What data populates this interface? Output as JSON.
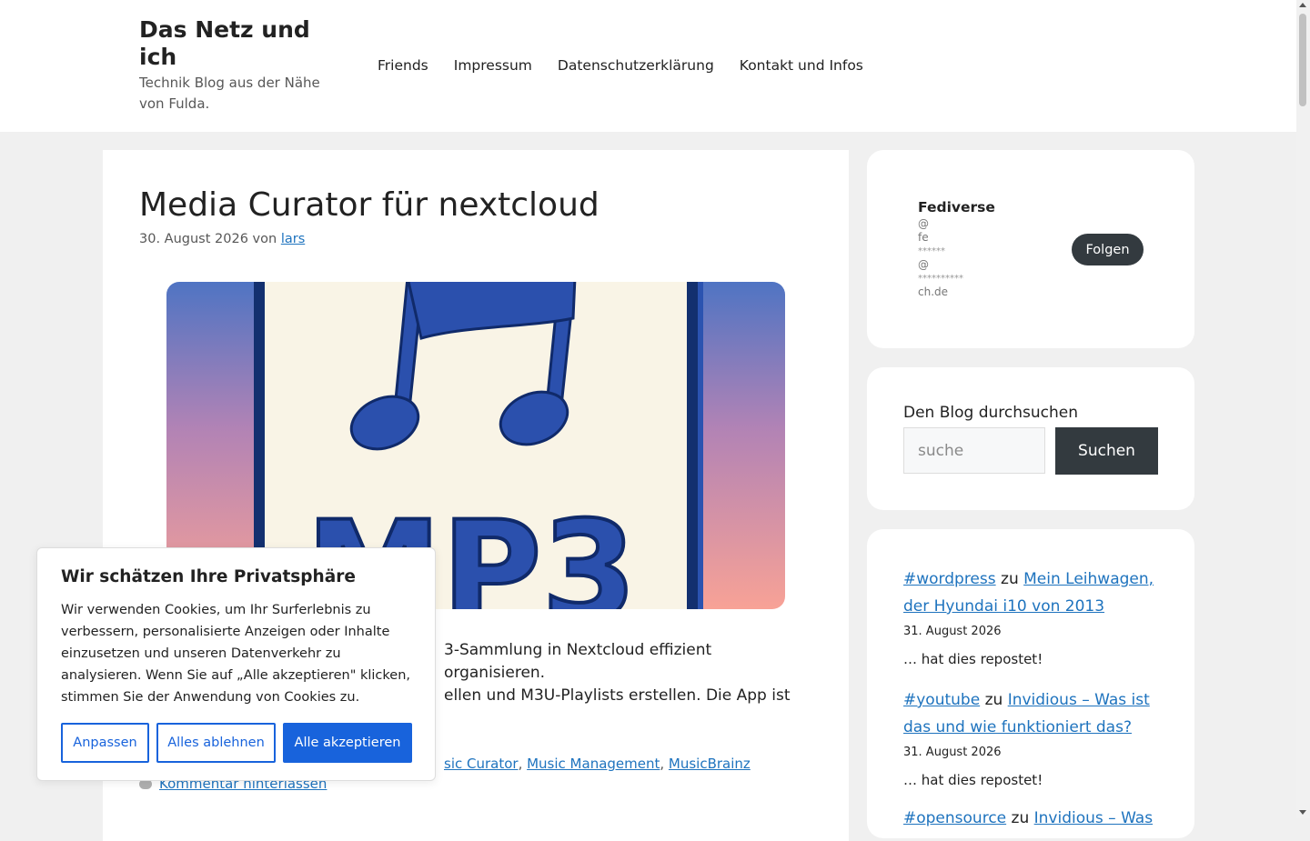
{
  "site": {
    "title": "Das Netz und ich",
    "tagline": "Technik Blog aus der Nähe von Fulda."
  },
  "nav": {
    "items": [
      "Friends",
      "Impressum",
      "Datenschutzerklärung",
      "Kontakt und Infos"
    ]
  },
  "post": {
    "title": "Media Curator für nextcloud",
    "date": "30. August 2026",
    "by": "von",
    "author": "lars",
    "image_text": "MP3",
    "excerpt_line1": "3-Sammlung in Nextcloud effizient organisieren.",
    "excerpt_line2": "ellen und M3U-Playlists erstellen. Die App ist",
    "tags": [
      "sic Curator",
      "Music Management",
      "MusicBrainz"
    ],
    "comment_link": "Kommentar hinterlassen"
  },
  "fediverse": {
    "title": "Fediverse",
    "handle_lines": [
      "@",
      "fe",
      "******",
      "@",
      "**********",
      "ch.de"
    ],
    "follow_label": "Folgen"
  },
  "search": {
    "label": "Den Blog durchsuchen",
    "placeholder": "suche",
    "button": "Suchen"
  },
  "reposts": {
    "items": [
      {
        "hashtag": "#wordpress",
        "connector": "zu",
        "title": "Mein Leihwagen, der Hyundai i10 von 2013",
        "date": "31. August 2026",
        "text": "… hat dies repostet!"
      },
      {
        "hashtag": "#youtube",
        "connector": "zu",
        "title": "Invidious – Was ist das und wie funktioniert das?",
        "date": "31. August 2026",
        "text": "… hat dies repostet!"
      },
      {
        "hashtag": "#opensource",
        "connector": "zu",
        "title": "Invidious – Was",
        "date": "",
        "text": ""
      }
    ]
  },
  "cookie": {
    "title": "Wir schätzen Ihre Privatsphäre",
    "text": "Wir verwenden Cookies, um Ihr Surferlebnis zu verbessern, personalisierte Anzeigen oder Inhalte einzusetzen und unseren Datenverkehr zu analysieren. Wenn Sie auf „Alle akzeptieren\" klicken, stimmen Sie der Anwendung von Cookies zu.",
    "customize": "Anpassen",
    "reject": "Alles ablehnen",
    "accept": "Alle akzeptieren"
  },
  "colors": {
    "link": "#1e73be",
    "dark_button": "#333a3f",
    "cookie_blue": "#1863dc",
    "page_bg": "#f0f0f0"
  }
}
